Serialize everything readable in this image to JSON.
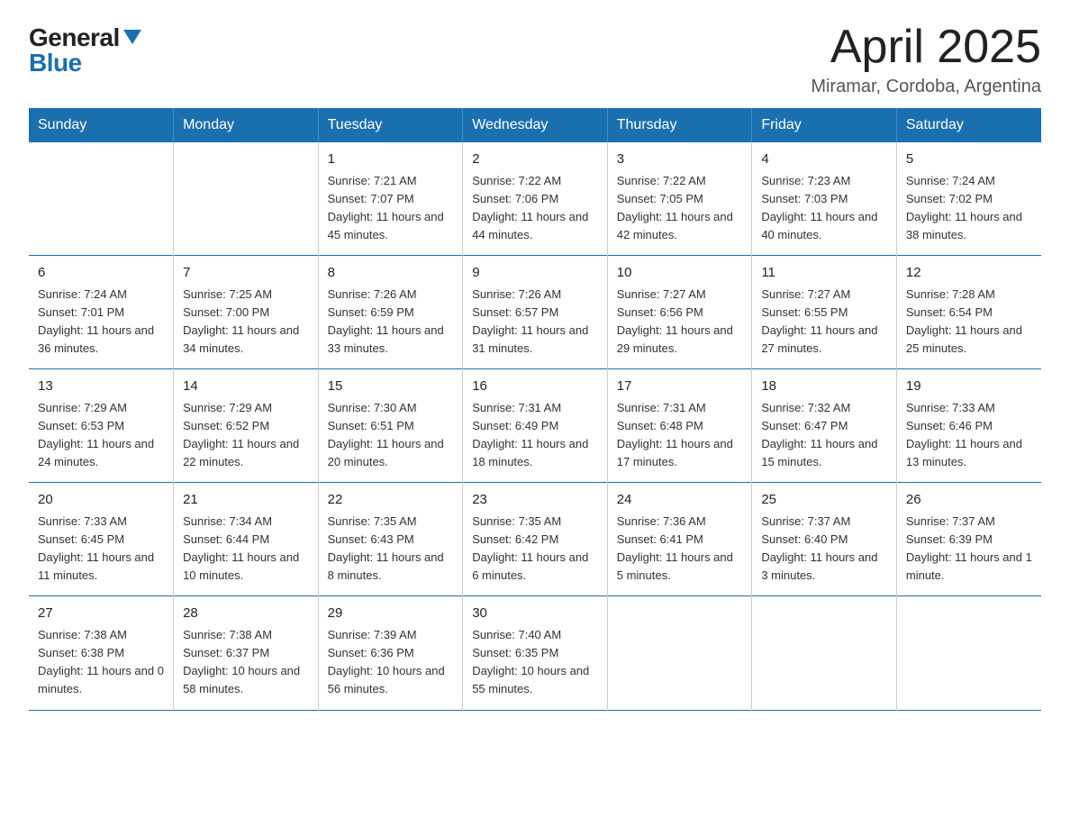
{
  "logo": {
    "general": "General",
    "blue": "Blue"
  },
  "title": "April 2025",
  "location": "Miramar, Cordoba, Argentina",
  "days_of_week": [
    "Sunday",
    "Monday",
    "Tuesday",
    "Wednesday",
    "Thursday",
    "Friday",
    "Saturday"
  ],
  "weeks": [
    [
      {
        "day": "",
        "sunrise": "",
        "sunset": "",
        "daylight": ""
      },
      {
        "day": "",
        "sunrise": "",
        "sunset": "",
        "daylight": ""
      },
      {
        "day": "1",
        "sunrise": "Sunrise: 7:21 AM",
        "sunset": "Sunset: 7:07 PM",
        "daylight": "Daylight: 11 hours and 45 minutes."
      },
      {
        "day": "2",
        "sunrise": "Sunrise: 7:22 AM",
        "sunset": "Sunset: 7:06 PM",
        "daylight": "Daylight: 11 hours and 44 minutes."
      },
      {
        "day": "3",
        "sunrise": "Sunrise: 7:22 AM",
        "sunset": "Sunset: 7:05 PM",
        "daylight": "Daylight: 11 hours and 42 minutes."
      },
      {
        "day": "4",
        "sunrise": "Sunrise: 7:23 AM",
        "sunset": "Sunset: 7:03 PM",
        "daylight": "Daylight: 11 hours and 40 minutes."
      },
      {
        "day": "5",
        "sunrise": "Sunrise: 7:24 AM",
        "sunset": "Sunset: 7:02 PM",
        "daylight": "Daylight: 11 hours and 38 minutes."
      }
    ],
    [
      {
        "day": "6",
        "sunrise": "Sunrise: 7:24 AM",
        "sunset": "Sunset: 7:01 PM",
        "daylight": "Daylight: 11 hours and 36 minutes."
      },
      {
        "day": "7",
        "sunrise": "Sunrise: 7:25 AM",
        "sunset": "Sunset: 7:00 PM",
        "daylight": "Daylight: 11 hours and 34 minutes."
      },
      {
        "day": "8",
        "sunrise": "Sunrise: 7:26 AM",
        "sunset": "Sunset: 6:59 PM",
        "daylight": "Daylight: 11 hours and 33 minutes."
      },
      {
        "day": "9",
        "sunrise": "Sunrise: 7:26 AM",
        "sunset": "Sunset: 6:57 PM",
        "daylight": "Daylight: 11 hours and 31 minutes."
      },
      {
        "day": "10",
        "sunrise": "Sunrise: 7:27 AM",
        "sunset": "Sunset: 6:56 PM",
        "daylight": "Daylight: 11 hours and 29 minutes."
      },
      {
        "day": "11",
        "sunrise": "Sunrise: 7:27 AM",
        "sunset": "Sunset: 6:55 PM",
        "daylight": "Daylight: 11 hours and 27 minutes."
      },
      {
        "day": "12",
        "sunrise": "Sunrise: 7:28 AM",
        "sunset": "Sunset: 6:54 PM",
        "daylight": "Daylight: 11 hours and 25 minutes."
      }
    ],
    [
      {
        "day": "13",
        "sunrise": "Sunrise: 7:29 AM",
        "sunset": "Sunset: 6:53 PM",
        "daylight": "Daylight: 11 hours and 24 minutes."
      },
      {
        "day": "14",
        "sunrise": "Sunrise: 7:29 AM",
        "sunset": "Sunset: 6:52 PM",
        "daylight": "Daylight: 11 hours and 22 minutes."
      },
      {
        "day": "15",
        "sunrise": "Sunrise: 7:30 AM",
        "sunset": "Sunset: 6:51 PM",
        "daylight": "Daylight: 11 hours and 20 minutes."
      },
      {
        "day": "16",
        "sunrise": "Sunrise: 7:31 AM",
        "sunset": "Sunset: 6:49 PM",
        "daylight": "Daylight: 11 hours and 18 minutes."
      },
      {
        "day": "17",
        "sunrise": "Sunrise: 7:31 AM",
        "sunset": "Sunset: 6:48 PM",
        "daylight": "Daylight: 11 hours and 17 minutes."
      },
      {
        "day": "18",
        "sunrise": "Sunrise: 7:32 AM",
        "sunset": "Sunset: 6:47 PM",
        "daylight": "Daylight: 11 hours and 15 minutes."
      },
      {
        "day": "19",
        "sunrise": "Sunrise: 7:33 AM",
        "sunset": "Sunset: 6:46 PM",
        "daylight": "Daylight: 11 hours and 13 minutes."
      }
    ],
    [
      {
        "day": "20",
        "sunrise": "Sunrise: 7:33 AM",
        "sunset": "Sunset: 6:45 PM",
        "daylight": "Daylight: 11 hours and 11 minutes."
      },
      {
        "day": "21",
        "sunrise": "Sunrise: 7:34 AM",
        "sunset": "Sunset: 6:44 PM",
        "daylight": "Daylight: 11 hours and 10 minutes."
      },
      {
        "day": "22",
        "sunrise": "Sunrise: 7:35 AM",
        "sunset": "Sunset: 6:43 PM",
        "daylight": "Daylight: 11 hours and 8 minutes."
      },
      {
        "day": "23",
        "sunrise": "Sunrise: 7:35 AM",
        "sunset": "Sunset: 6:42 PM",
        "daylight": "Daylight: 11 hours and 6 minutes."
      },
      {
        "day": "24",
        "sunrise": "Sunrise: 7:36 AM",
        "sunset": "Sunset: 6:41 PM",
        "daylight": "Daylight: 11 hours and 5 minutes."
      },
      {
        "day": "25",
        "sunrise": "Sunrise: 7:37 AM",
        "sunset": "Sunset: 6:40 PM",
        "daylight": "Daylight: 11 hours and 3 minutes."
      },
      {
        "day": "26",
        "sunrise": "Sunrise: 7:37 AM",
        "sunset": "Sunset: 6:39 PM",
        "daylight": "Daylight: 11 hours and 1 minute."
      }
    ],
    [
      {
        "day": "27",
        "sunrise": "Sunrise: 7:38 AM",
        "sunset": "Sunset: 6:38 PM",
        "daylight": "Daylight: 11 hours and 0 minutes."
      },
      {
        "day": "28",
        "sunrise": "Sunrise: 7:38 AM",
        "sunset": "Sunset: 6:37 PM",
        "daylight": "Daylight: 10 hours and 58 minutes."
      },
      {
        "day": "29",
        "sunrise": "Sunrise: 7:39 AM",
        "sunset": "Sunset: 6:36 PM",
        "daylight": "Daylight: 10 hours and 56 minutes."
      },
      {
        "day": "30",
        "sunrise": "Sunrise: 7:40 AM",
        "sunset": "Sunset: 6:35 PM",
        "daylight": "Daylight: 10 hours and 55 minutes."
      },
      {
        "day": "",
        "sunrise": "",
        "sunset": "",
        "daylight": ""
      },
      {
        "day": "",
        "sunrise": "",
        "sunset": "",
        "daylight": ""
      },
      {
        "day": "",
        "sunrise": "",
        "sunset": "",
        "daylight": ""
      }
    ]
  ]
}
